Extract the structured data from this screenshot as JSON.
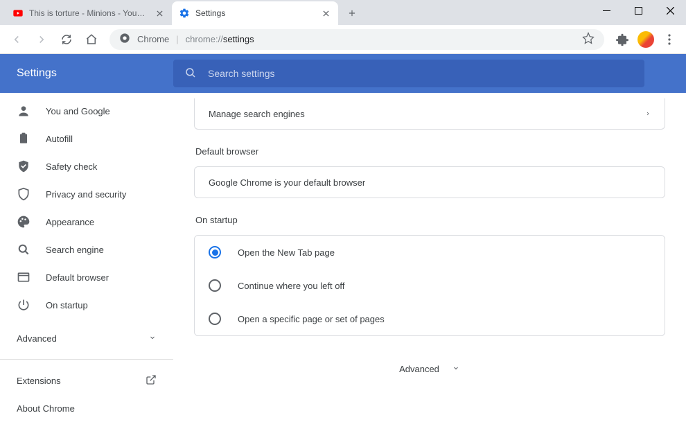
{
  "window": {
    "tabs": [
      {
        "title": "This is torture - Minions - YouTube",
        "favicon": "youtube"
      },
      {
        "title": "Settings",
        "favicon": "settings"
      }
    ],
    "active_tab_index": 1
  },
  "omnibox": {
    "label": "Chrome",
    "url_prefix": "chrome://",
    "url_path": "settings"
  },
  "settings": {
    "title": "Settings",
    "search_placeholder": "Search settings",
    "sidebar": {
      "items": [
        {
          "icon": "user",
          "label": "You and Google"
        },
        {
          "icon": "clipboard",
          "label": "Autofill"
        },
        {
          "icon": "shield-check",
          "label": "Safety check"
        },
        {
          "icon": "shield",
          "label": "Privacy and security"
        },
        {
          "icon": "palette",
          "label": "Appearance"
        },
        {
          "icon": "search",
          "label": "Search engine"
        },
        {
          "icon": "browser",
          "label": "Default browser"
        },
        {
          "icon": "power",
          "label": "On startup"
        }
      ],
      "advanced_label": "Advanced",
      "extensions_label": "Extensions",
      "about_label": "About Chrome"
    },
    "content": {
      "manage_search_engines": "Manage search engines",
      "default_browser_title": "Default browser",
      "default_browser_text": "Google Chrome is your default browser",
      "on_startup_title": "On startup",
      "startup_options": [
        "Open the New Tab page",
        "Continue where you left off",
        "Open a specific page or set of pages"
      ],
      "startup_selected_index": 0,
      "advanced_footer": "Advanced"
    }
  }
}
